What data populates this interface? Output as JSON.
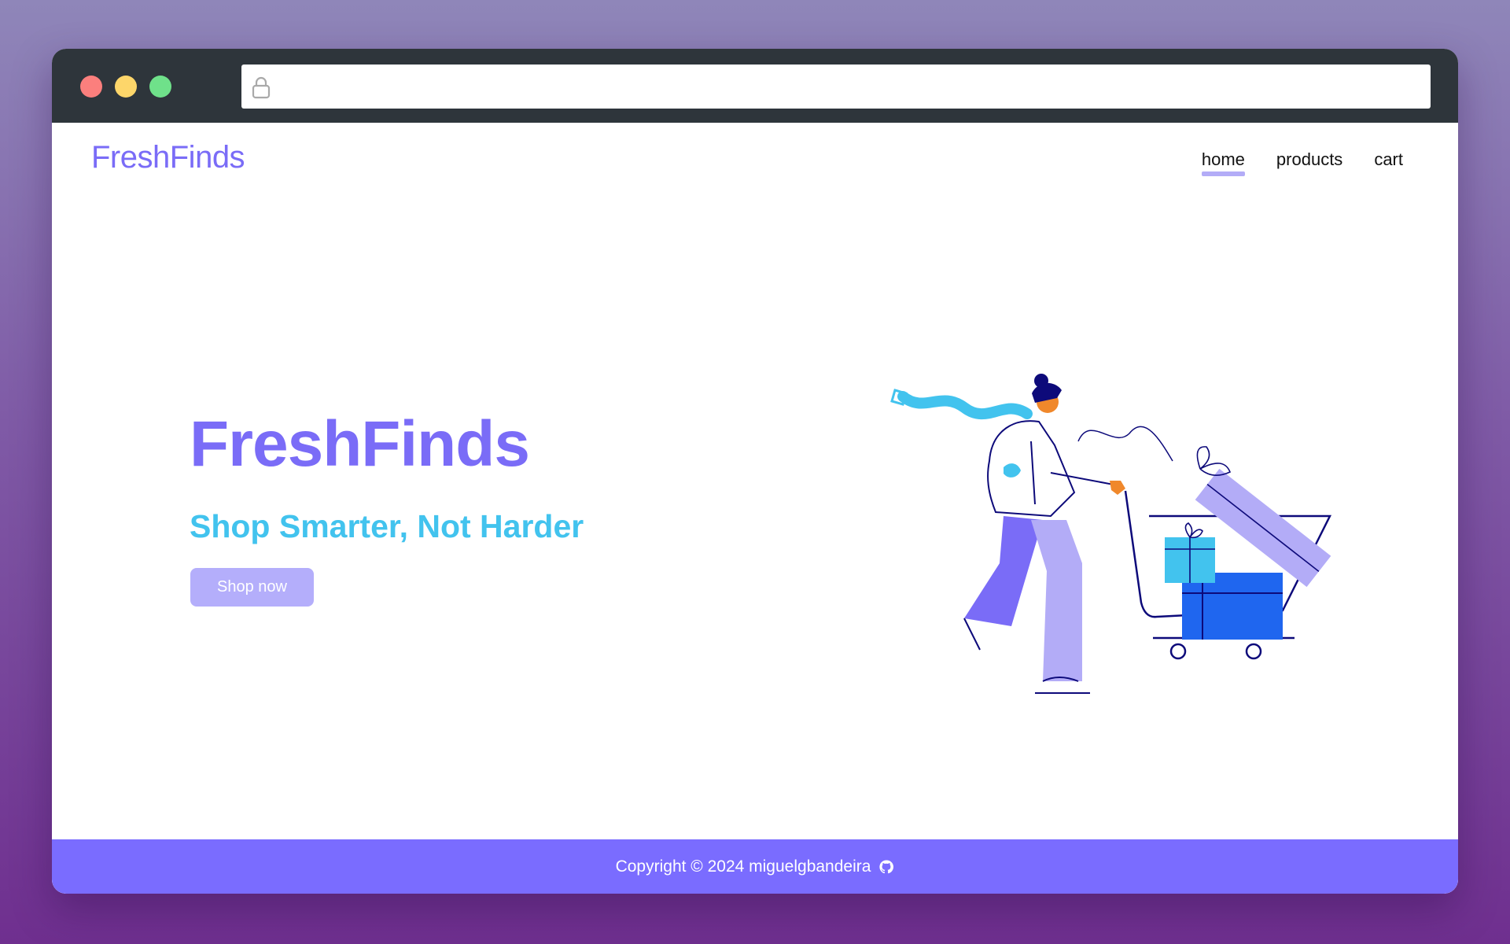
{
  "browser": {
    "url_text": "",
    "colors": {
      "close": "#fb7f7d",
      "minimize": "#fdd66a",
      "zoom": "#6fe18a"
    }
  },
  "header": {
    "brand": "FreshFinds",
    "nav": [
      {
        "label": "home",
        "active": true
      },
      {
        "label": "products",
        "active": false
      },
      {
        "label": "cart",
        "active": false
      }
    ]
  },
  "hero": {
    "title": "FreshFinds",
    "subtitle": "Shop Smarter, Not Harder",
    "cta": "Shop now",
    "illustration_icon": "woman-pushing-shopping-cart-with-gifts"
  },
  "footer": {
    "text": "Copyright © 2024 miguelgbandeira",
    "icon": "github-icon"
  },
  "theme": {
    "primary": "#7a6cf7",
    "accent": "#42c3ee",
    "button": "#b4aefb"
  }
}
